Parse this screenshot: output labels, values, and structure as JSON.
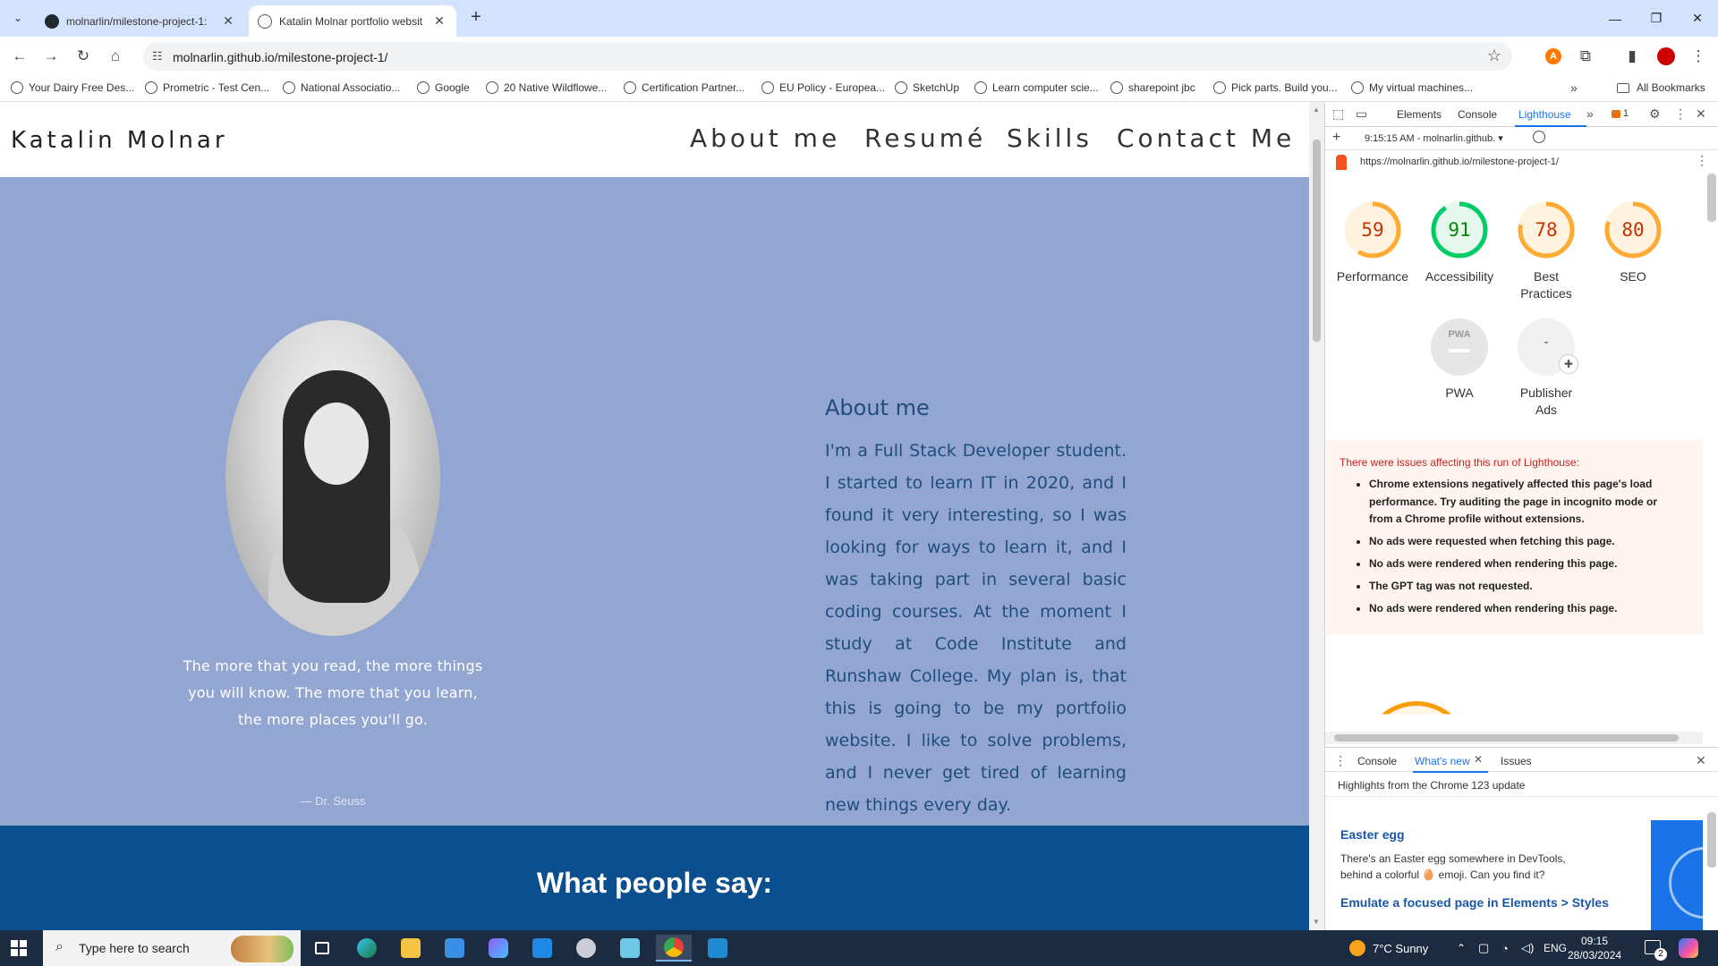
{
  "browser": {
    "tabs": [
      {
        "title": "molnarlin/milestone-project-1:",
        "favicon": "github-icon"
      },
      {
        "title": "Katalin Molnar portfolio websit",
        "favicon": "globe-icon"
      }
    ],
    "url": "molnarlin.github.io/milestone-project-1/",
    "bookmarks": [
      "Your Dairy Free Des...",
      "Prometric - Test Cen...",
      "National Associatio...",
      "Google",
      "20 Native Wildflowe...",
      "Certification Partner...",
      "EU Policy - Europea...",
      "SketchUp",
      "Learn computer scie...",
      "sharepoint jbc",
      "Pick parts. Build you...",
      "My virtual machines..."
    ],
    "all_bookmarks": "All Bookmarks"
  },
  "site": {
    "brand": "Katalin Molnar",
    "nav": [
      "About me",
      "Resumé",
      "Skills",
      "Contact Me"
    ],
    "quote": "The more that you read, the more things you will know. The more that you learn, the more places you'll go.",
    "quote_author": "— Dr. Seuss",
    "about_title": "About me",
    "about_text": "I'm a Full Stack Developer student. I started to learn IT in 2020, and I found it very interesting, so I was looking for ways to learn it, and I was taking part in several basic coding courses. At the moment I study at Code Institute and Runshaw College. My plan is, that this is going to be my portfolio website. I like to solve problems, and I never get tired of learning new things every day.",
    "testimonials_title": "What people say:",
    "colors": {
      "about_bg": "#93a6d1",
      "about_text": "#1f4e7e",
      "testimonials_bg": "#0c4f8e"
    }
  },
  "devtools": {
    "tabs": [
      "Elements",
      "Console",
      "Lighthouse"
    ],
    "active_tab": "Lighthouse",
    "issues_count": "1",
    "run_label": "9:15:15 AM - molnarlin.github.",
    "report_url": "https://molnarlin.github.io/milestone-project-1/",
    "scores": [
      {
        "label": "Performance",
        "score": 59,
        "color": "#fa3",
        "track": "#fff3e0",
        "text_color": "#c33300"
      },
      {
        "label": "Accessibility",
        "score": 91,
        "color": "#0c6",
        "track": "#e6f7ed",
        "text_color": "#008800"
      },
      {
        "label": "Best Practices",
        "score": 78,
        "color": "#fa3",
        "track": "#fff3e0",
        "text_color": "#c33300"
      },
      {
        "label": "SEO",
        "score": 80,
        "color": "#fa3",
        "track": "#fff3e0",
        "text_color": "#c33300"
      }
    ],
    "pwa": {
      "label": "PWA",
      "badge": "PWA"
    },
    "publisher_ads": {
      "label": "Publisher Ads",
      "value": "-"
    },
    "warning_heading": "There were issues affecting this run of Lighthouse:",
    "warnings": [
      "Chrome extensions negatively affected this page's load performance. Try auditing the page in incognito mode or from a Chrome profile without extensions.",
      "No ads were requested when fetching this page.",
      "No ads were rendered when rendering this page.",
      "The GPT tag was not requested.",
      "No ads were rendered when rendering this page."
    ],
    "drawer_tabs": [
      "Console",
      "What's new",
      "Issues"
    ],
    "drawer_active": "What's new",
    "highlights": "Highlights from the Chrome 123 update",
    "easter_title": "Easter egg",
    "easter_text": "There's an Easter egg somewhere in DevTools, behind a colorful 🥚 emoji. Can you find it?",
    "emulate_title": "Emulate a focused page in Elements > Styles"
  },
  "taskbar": {
    "search_placeholder": "Type here to search",
    "weather": "7°C  Sunny",
    "language": "ENG",
    "time": "09:15",
    "date": "28/03/2024",
    "notification_count": "2"
  }
}
